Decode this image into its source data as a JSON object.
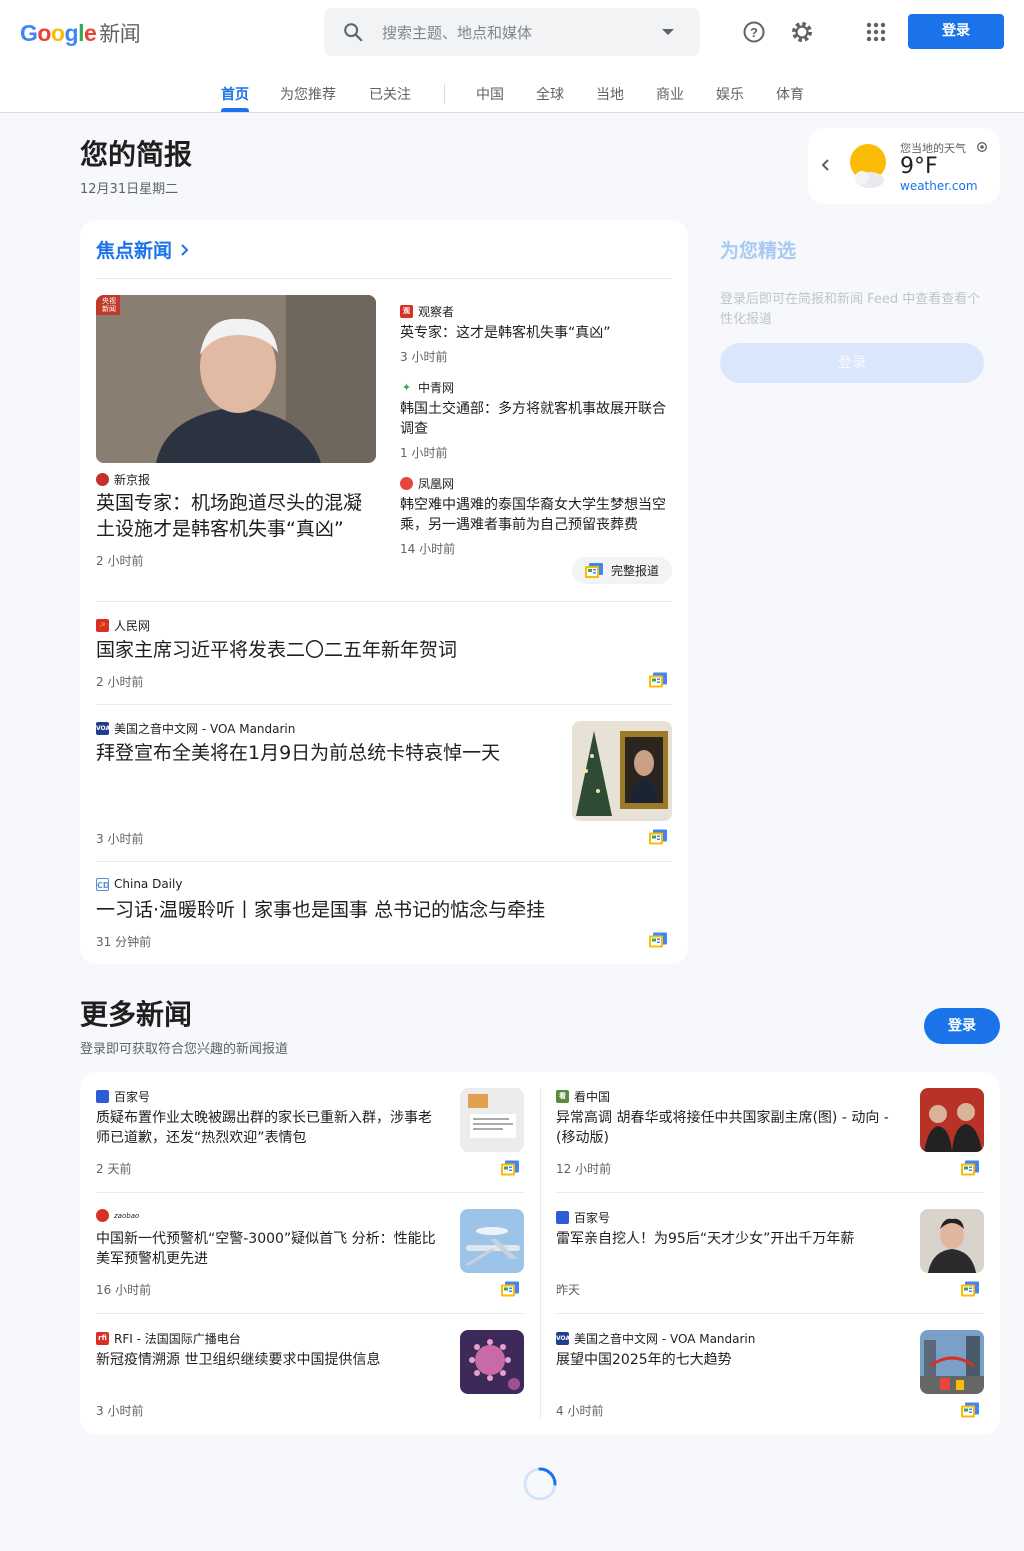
{
  "header": {
    "logo": {
      "g": "G",
      "o1": "o",
      "o2": "o",
      "g2": "g",
      "l": "l",
      "e": "e",
      "news": "新闻"
    },
    "search_placeholder": "搜索主题、地点和媒体",
    "signin_label": "登录"
  },
  "tabs": [
    "首页",
    "为您推荐",
    "已关注",
    "中国",
    "全球",
    "当地",
    "商业",
    "娱乐",
    "体育"
  ],
  "briefing": {
    "title": "您的简报",
    "date": "12月31日星期二"
  },
  "weather": {
    "label": "您当地的天气",
    "temp": "9°F",
    "source": "weather.com"
  },
  "top_stories": {
    "heading": "焦点新闻",
    "main": {
      "source": "新京报",
      "headline": "英国专家：机场跑道尽头的混凝土设施才是韩客机失事“真凶”",
      "time": "2 小时前",
      "thumb_badge": "央视新闻"
    },
    "side": [
      {
        "source": "观察者",
        "headline": "英专家：这才是韩客机失事“真凶”",
        "time": "3 小时前"
      },
      {
        "source": "中青网",
        "headline": "韩国土交通部：多方将就客机事故展开联合调查",
        "time": "1 小时前"
      },
      {
        "source": "凤凰网",
        "headline": "韩空难中遇难的泰国华裔女大学生梦想当空乘，另一遇难者事前为自己预留丧葬费",
        "time": "14 小时前"
      }
    ],
    "full_coverage": "完整报道",
    "more": [
      {
        "source": "人民网",
        "headline": "国家主席习近平将发表二〇二五年新年贺词",
        "time": "2 小时前"
      },
      {
        "source": "美国之音中文网 - VOA Mandarin",
        "headline": "拜登宣布全美将在1月9日为前总统卡特哀悼一天",
        "time": "3 小时前"
      },
      {
        "source": "China Daily",
        "headline": "一习话·温暖聆听丨家事也是国事 总书记的惦念与牵挂",
        "time": "31 分钟前"
      }
    ]
  },
  "picks": {
    "title": "为您精选",
    "desc": "登录后即可在简报和新闻 Feed 中查看查看个性化报道",
    "button": "登录"
  },
  "more_news": {
    "title": "更多新闻",
    "subtitle": "登录即可获取符合您兴趣的新闻报道",
    "button": "登录",
    "items": [
      {
        "source": "百家号",
        "headline": "质疑布置作业太晚被踢出群的家长已重新入群，涉事老师已道歉，还发“热烈欢迎”表情包",
        "time": "2 天前"
      },
      {
        "source": "看中国",
        "headline": "异常高调 胡春华或将接任中共国家副主席(图) - 动向 - (移动版)",
        "time": "12 小时前"
      },
      {
        "source": "zaobao",
        "headline": "中国新一代预警机“空警-3000”疑似首飞 分析：性能比美军预警机更先进",
        "time": "16 小时前"
      },
      {
        "source": "百家号",
        "headline": "雷军亲自挖人！为95后“天才少女”开出千万年薪",
        "time": "昨天"
      },
      {
        "source": "RFI - 法国国际广播电台",
        "headline": "新冠疫情溯源 世卫组织继续要求中国提供信息",
        "time": "3 小时前"
      },
      {
        "source": "美国之音中文网 - VOA Mandarin",
        "headline": "展望中国2025年的七大趋势",
        "time": "4 小时前"
      }
    ]
  },
  "colors": {
    "accent": "#1a73e8",
    "background": "#f6f8fc"
  },
  "icons": [
    "search-icon",
    "help-icon",
    "settings-icon",
    "apps-icon",
    "chevron-right-icon",
    "chevron-left-icon",
    "location-icon",
    "full-coverage-icon",
    "loading-spinner"
  ]
}
